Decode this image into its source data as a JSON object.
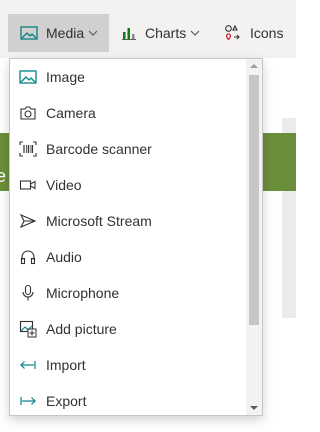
{
  "toolbar": {
    "media_label": "Media",
    "charts_label": "Charts",
    "icons_label": "Icons"
  },
  "menu": {
    "items": [
      {
        "label": "Image",
        "icon": "image-icon"
      },
      {
        "label": "Camera",
        "icon": "camera-icon"
      },
      {
        "label": "Barcode scanner",
        "icon": "barcode-scanner-icon"
      },
      {
        "label": "Video",
        "icon": "video-icon"
      },
      {
        "label": "Microsoft Stream",
        "icon": "stream-icon"
      },
      {
        "label": "Audio",
        "icon": "headphones-icon"
      },
      {
        "label": "Microphone",
        "icon": "microphone-icon"
      },
      {
        "label": "Add picture",
        "icon": "add-picture-icon"
      },
      {
        "label": "Import",
        "icon": "import-icon"
      },
      {
        "label": "Export",
        "icon": "export-icon"
      }
    ]
  },
  "background": {
    "partial_text": "e"
  },
  "colors": {
    "accent_teal": "#038387",
    "chart_green": "#107c10",
    "band_green": "#6b8e3a"
  }
}
